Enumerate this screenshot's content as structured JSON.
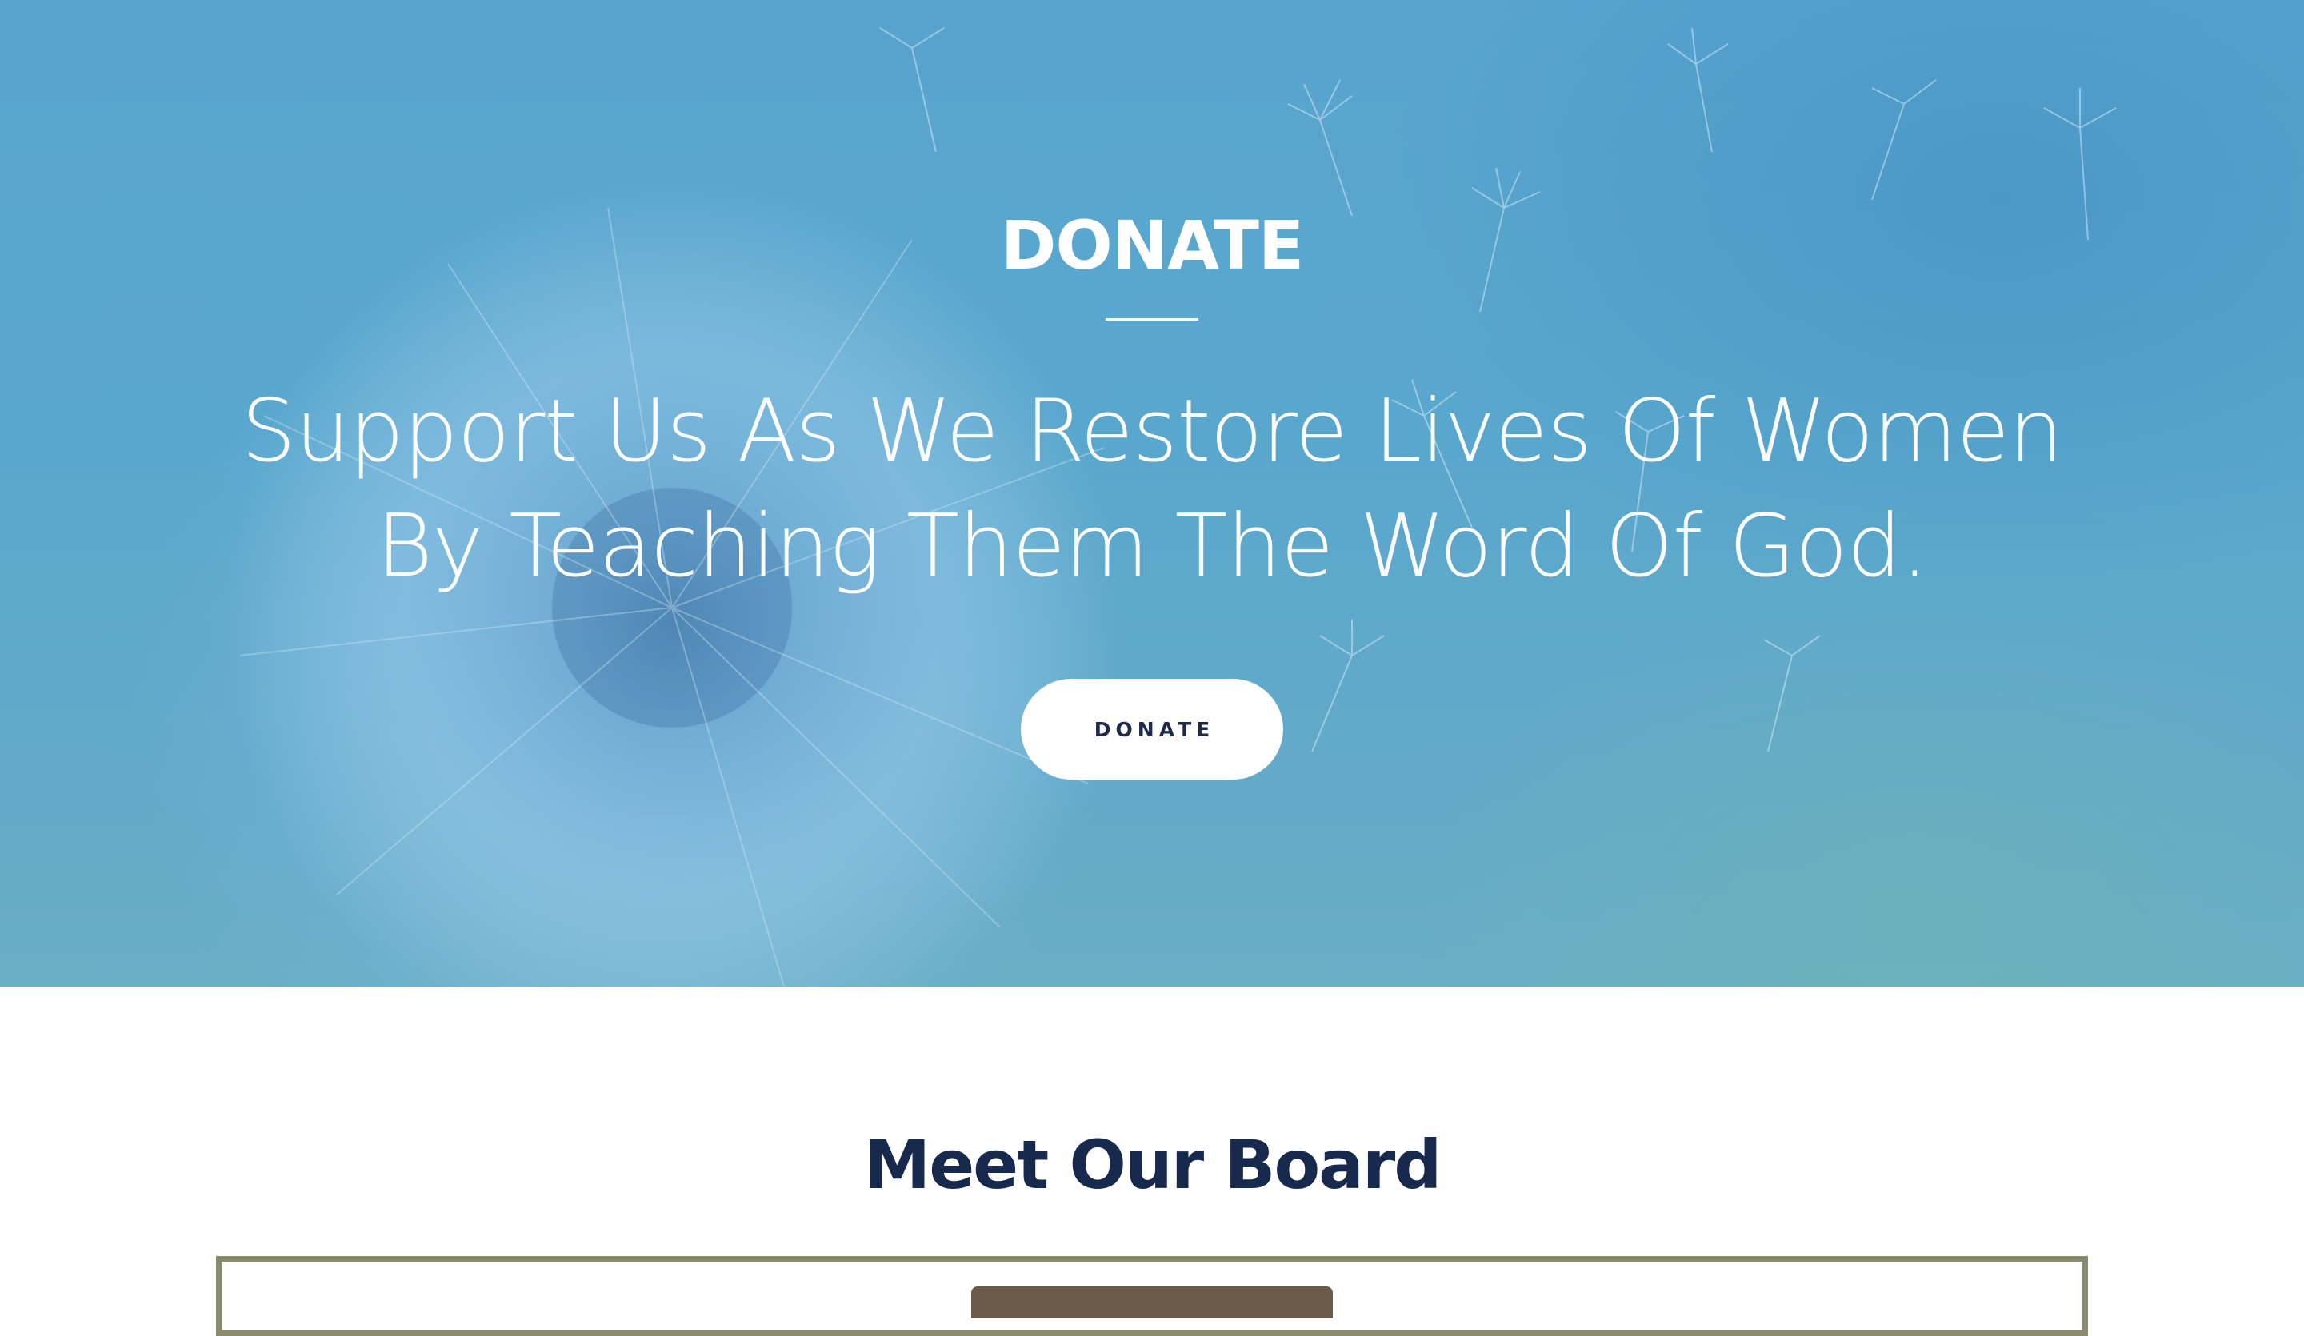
{
  "hero": {
    "title": "DONATE",
    "subtitle_line1": "Support Us As We Restore Lives Of Women",
    "subtitle_line2": "By Teaching Them The Word Of God.",
    "button_label": "DONATE",
    "background_image": "dandelion-seeds"
  },
  "board": {
    "title": "Meet Our Board"
  },
  "colors": {
    "hero_bg": "#5aa7cd",
    "heading_navy": "#17294d",
    "button_text": "#1d2a4a",
    "frame_border": "#8a8b6c"
  }
}
